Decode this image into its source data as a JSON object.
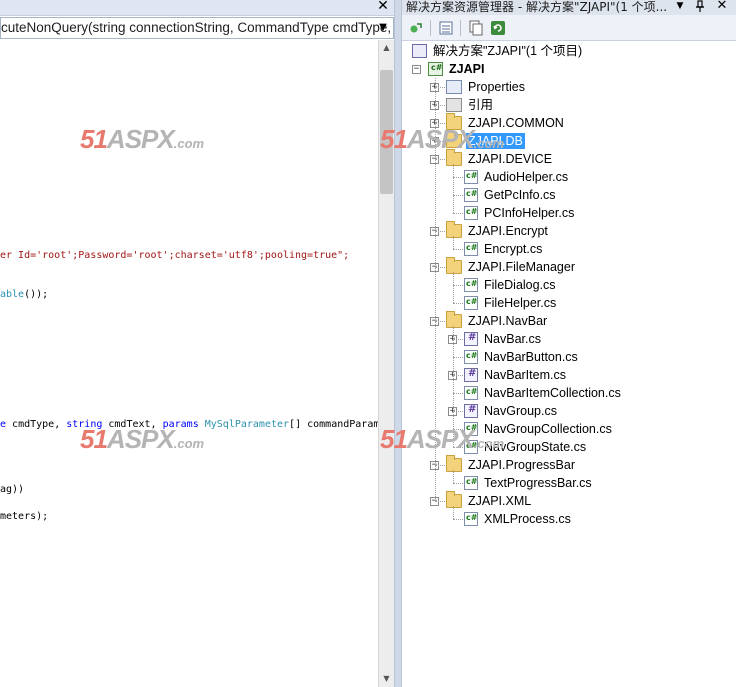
{
  "editor": {
    "member_dropdown": "cuteNonQuery(string connectionString, CommandType cmdType, s",
    "code_lines": [
      {
        "segments": [
          {
            "text": "er Id='root';Password='root';charset='utf8';pooling=true\";",
            "cls": "c-red"
          }
        ]
      },
      {
        "segments": [
          {
            "text": "able",
            "cls": "c-teal"
          },
          {
            "text": "());",
            "cls": ""
          }
        ]
      },
      {
        "segments": [
          {
            "text": "e",
            "cls": "c-blue"
          },
          {
            "text": " cmdType, ",
            "cls": ""
          },
          {
            "text": "string",
            "cls": "c-blue"
          },
          {
            "text": " cmdText, ",
            "cls": ""
          },
          {
            "text": "params",
            "cls": "c-blue"
          },
          {
            "text": " ",
            "cls": ""
          },
          {
            "text": "MySqlParameter",
            "cls": "c-teal"
          },
          {
            "text": "[] commandParam",
            "cls": ""
          }
        ]
      },
      {
        "segments": [
          {
            "text": "ag))",
            "cls": ""
          }
        ]
      },
      {
        "segments": [
          {
            "text": "meters);",
            "cls": ""
          }
        ]
      }
    ]
  },
  "explorer": {
    "title": "解决方案资源管理器 - 解决方案\"ZJAPI\"(1 个项...",
    "tree": [
      {
        "label": "解决方案\"ZJAPI\"(1 个项目)",
        "icon": "solution-icon",
        "level": 0,
        "expander": "",
        "bold": false,
        "selected": false
      },
      {
        "label": "ZJAPI",
        "icon": "csharp-project-icon",
        "level": 0,
        "expander": "-",
        "bold": true,
        "selected": false
      },
      {
        "label": "Properties",
        "icon": "properties-icon",
        "level": 1,
        "expander": "+",
        "bold": false,
        "selected": false
      },
      {
        "label": "引用",
        "icon": "references-icon",
        "level": 1,
        "expander": "+",
        "bold": false,
        "selected": false
      },
      {
        "label": "ZJAPI.COMMON",
        "icon": "folder-icon",
        "level": 1,
        "expander": "+",
        "bold": false,
        "selected": false
      },
      {
        "label": "ZJAPI.DB",
        "icon": "folder-icon",
        "level": 1,
        "expander": "+",
        "bold": false,
        "selected": true
      },
      {
        "label": "ZJAPI.DEVICE",
        "icon": "folder-open-icon",
        "level": 1,
        "expander": "-",
        "bold": false,
        "selected": false
      },
      {
        "label": "AudioHelper.cs",
        "icon": "csharp-file-icon",
        "level": 2,
        "expander": "",
        "bold": false,
        "selected": false
      },
      {
        "label": "GetPcInfo.cs",
        "icon": "csharp-file-icon",
        "level": 2,
        "expander": "",
        "bold": false,
        "selected": false
      },
      {
        "label": "PCInfoHelper.cs",
        "icon": "csharp-file-icon",
        "level": 2,
        "expander": "",
        "bold": false,
        "selected": false
      },
      {
        "label": "ZJAPI.Encrypt",
        "icon": "folder-open-icon",
        "level": 1,
        "expander": "-",
        "bold": false,
        "selected": false
      },
      {
        "label": "Encrypt.cs",
        "icon": "csharp-file-icon",
        "level": 2,
        "expander": "",
        "bold": false,
        "selected": false
      },
      {
        "label": "ZJAPI.FileManager",
        "icon": "folder-open-icon",
        "level": 1,
        "expander": "-",
        "bold": false,
        "selected": false
      },
      {
        "label": "FileDialog.cs",
        "icon": "csharp-file-icon",
        "level": 2,
        "expander": "",
        "bold": false,
        "selected": false
      },
      {
        "label": "FileHelper.cs",
        "icon": "csharp-file-icon",
        "level": 2,
        "expander": "",
        "bold": false,
        "selected": false
      },
      {
        "label": "ZJAPI.NavBar",
        "icon": "folder-open-icon",
        "level": 1,
        "expander": "-",
        "bold": false,
        "selected": false
      },
      {
        "label": "NavBar.cs",
        "icon": "csharp-class-icon",
        "level": 2,
        "expander": "+",
        "bold": false,
        "selected": false
      },
      {
        "label": "NavBarButton.cs",
        "icon": "csharp-file-icon",
        "level": 2,
        "expander": "",
        "bold": false,
        "selected": false
      },
      {
        "label": "NavBarItem.cs",
        "icon": "csharp-class-icon",
        "level": 2,
        "expander": "+",
        "bold": false,
        "selected": false
      },
      {
        "label": "NavBarItemCollection.cs",
        "icon": "csharp-file-icon",
        "level": 2,
        "expander": "",
        "bold": false,
        "selected": false
      },
      {
        "label": "NavGroup.cs",
        "icon": "csharp-class-icon",
        "level": 2,
        "expander": "+",
        "bold": false,
        "selected": false
      },
      {
        "label": "NavGroupCollection.cs",
        "icon": "csharp-file-icon",
        "level": 2,
        "expander": "",
        "bold": false,
        "selected": false
      },
      {
        "label": "NavGroupState.cs",
        "icon": "csharp-file-icon",
        "level": 2,
        "expander": "",
        "bold": false,
        "selected": false
      },
      {
        "label": "ZJAPI.ProgressBar",
        "icon": "folder-open-icon",
        "level": 1,
        "expander": "-",
        "bold": false,
        "selected": false
      },
      {
        "label": "TextProgressBar.cs",
        "icon": "csharp-file-icon",
        "level": 2,
        "expander": "",
        "bold": false,
        "selected": false
      },
      {
        "label": "ZJAPI.XML",
        "icon": "folder-open-icon",
        "level": 1,
        "expander": "-",
        "bold": false,
        "selected": false
      },
      {
        "label": "XMLProcess.cs",
        "icon": "csharp-file-icon",
        "level": 2,
        "expander": "",
        "bold": false,
        "selected": false
      }
    ]
  },
  "watermark": {
    "num": "51",
    "name": "ASPX",
    "domain": ".com"
  }
}
